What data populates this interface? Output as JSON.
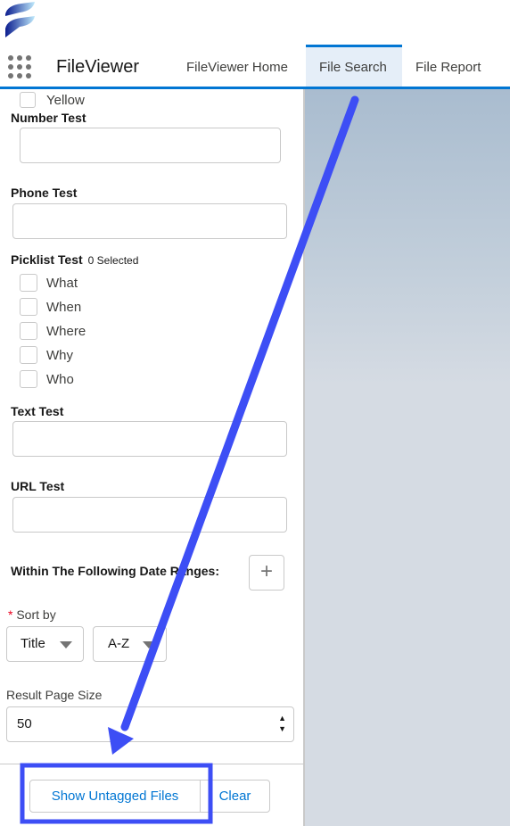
{
  "app": {
    "name": "FileViewer"
  },
  "nav": {
    "tabs": [
      {
        "label": "FileViewer Home"
      },
      {
        "label": "File Search",
        "active": true
      },
      {
        "label": "File Report"
      }
    ]
  },
  "form": {
    "partial_option": "Yellow",
    "number_label": "Number Test",
    "phone_label": "Phone Test",
    "picklist_label": "Picklist Test",
    "picklist_count": "0 Selected",
    "picklist_options": [
      "What",
      "When",
      "Where",
      "Why",
      "Who"
    ],
    "text_label": "Text Test",
    "url_label": "URL Test",
    "date_ranges_label": "Within The Following Date Ranges:",
    "sort_label": "Sort by",
    "sort_field": "Title",
    "sort_order": "A-Z",
    "page_size_label": "Result Page Size",
    "page_size": "50"
  },
  "actions": {
    "untagged": "Show Untagged Files",
    "clear": "Clear"
  },
  "colors": {
    "brand": "#0176d3",
    "annotation": "#3d4ef5"
  }
}
